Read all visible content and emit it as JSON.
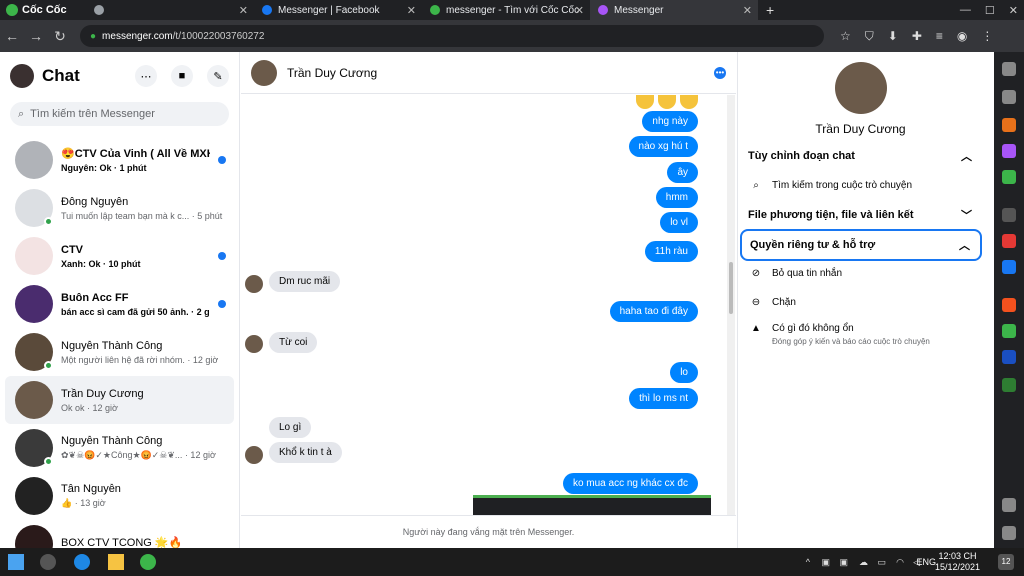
{
  "browser": {
    "brand": "Cốc Cốc",
    "tabs": [
      {
        "title": "",
        "color": "#9aa0a6"
      },
      {
        "title": "Messenger | Facebook",
        "color": "#1877f2"
      },
      {
        "title": "messenger - Tìm với Cốc Cốc",
        "color": "#3cb54a"
      },
      {
        "title": "Messenger",
        "color": "#a855f7"
      }
    ],
    "url_host": "messenger.com",
    "url_path": "/t/100022003760272"
  },
  "left": {
    "title": "Chat",
    "search_placeholder": "Tìm kiếm trên Messenger",
    "conversations": [
      {
        "name": "😍CTV Của Vinh ( All Về MXH ) 😍",
        "snippet": "Nguyên: Ok",
        "time": "· 1 phút",
        "unread": true,
        "online": false,
        "avatar_color": "#b0b3b8"
      },
      {
        "name": "Đông Nguyên",
        "snippet": "Tui muốn lập team bạn mà k c...",
        "time": "· 5 phút",
        "unread": false,
        "online": true,
        "avatar_color": "#dcdfe3"
      },
      {
        "name": "CTV",
        "snippet": "Xanh: Ok",
        "time": "· 10 phút",
        "unread": true,
        "online": false,
        "avatar_color": "#f3e3e3"
      },
      {
        "name": "Buôn Acc FF",
        "snippet": "bán acc sì cam đã gửi 50 ảnh.",
        "time": "· 2 giờ",
        "unread": true,
        "online": false,
        "avatar_color": "#4a2c6e"
      },
      {
        "name": "Nguyễn Thành Công",
        "snippet": "Một người liên hệ đã rời nhóm.",
        "time": "· 12 giờ",
        "unread": false,
        "online": true,
        "avatar_color": "#5a4a3a"
      },
      {
        "name": "Trần Duy Cương",
        "snippet": "Ok ok",
        "time": "· 12 giờ",
        "unread": false,
        "online": false,
        "avatar_color": "#6b5a4a",
        "selected": true
      },
      {
        "name": "Nguyễn Thành Công",
        "snippet": "✿❦☠😡✓★Công★😡✓☠❦...",
        "time": "· 12 giờ",
        "unread": false,
        "online": true,
        "avatar_color": "#3a3a3a"
      },
      {
        "name": "Tân Nguyễn",
        "snippet": "👍",
        "time": "· 13 giờ",
        "unread": false,
        "online": false,
        "avatar_color": "#222"
      },
      {
        "name": "BOX CTV TCONG 🌟🔥",
        "snippet": "",
        "time": "",
        "unread": false,
        "online": false,
        "avatar_color": "#2a1a1a"
      }
    ]
  },
  "chat": {
    "contact_name": "Trần Duy Cương",
    "messages_out_1": [
      "nhg này",
      "nào xg hú t",
      "ây",
      "hmm",
      "lo vl",
      "11h ràu"
    ],
    "message_in_1": "Dm ruc mãi",
    "message_out_2": "haha tao đi đây",
    "message_in_2": "Từ coi",
    "messages_out_3": [
      "lo",
      "thì lo ms nt"
    ],
    "message_in_3a": "Lo gì",
    "message_in_3b": "Khổ k tin t à",
    "message_out_4": "ko mua acc ng khác cx đc",
    "absent_notice": "Người này đang vắng mặt trên Messenger."
  },
  "right": {
    "contact_name": "Trần Duy Cương",
    "sections": {
      "customize": "Tùy chỉnh đoạn chat",
      "search_in_convo": "Tìm kiếm trong cuộc trò chuyện",
      "media": "File phương tiện, file và liên kết",
      "privacy": "Quyền riêng tư & hỗ trợ",
      "ignore": "Bỏ qua tin nhắn",
      "block": "Chặn",
      "report": "Có gì đó không ổn",
      "report_sub": "Đóng góp ý kiến và báo cáo cuộc trò chuyện"
    }
  },
  "taskbar": {
    "lang": "ENG",
    "time": "12:03 CH",
    "date": "15/12/2021",
    "notifications": "12"
  }
}
